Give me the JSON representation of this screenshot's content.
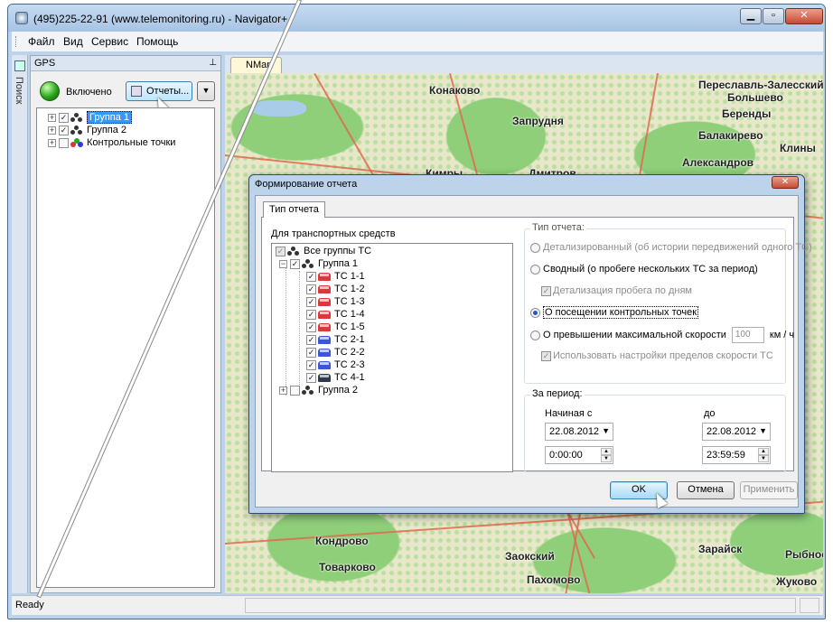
{
  "window": {
    "title": "(495)225-22-91  (www.telemonitoring.ru) - Navigator+",
    "minimize_glyph": "▁",
    "maximize_glyph": "▫",
    "close_glyph": "✕"
  },
  "menu": [
    "Файл",
    "Вид",
    "Сервис",
    "Помощь"
  ],
  "side_tab": "Поиск",
  "gps_panel": {
    "title": "GPS",
    "pin_glyph": "⊥",
    "status": "Включено",
    "reports_button": "Отчеты...",
    "dropdown_glyph": "▼",
    "tree": [
      {
        "label": "Группа 1",
        "checked": true,
        "selected": true
      },
      {
        "label": "Группа 2",
        "checked": true,
        "selected": false
      },
      {
        "label": "Контрольные точки",
        "checked": false,
        "selected": false
      }
    ]
  },
  "map": {
    "tab_label": "NMap",
    "cities": [
      "Переславль-Залесский",
      "Конаково",
      "Большево",
      "Беренды",
      "Запрудня",
      "Балакирево",
      "Клины",
      "Александров",
      "Кимры",
      "Дмитров",
      "Кондрово",
      "Товарково",
      "Заокский",
      "Пахомово",
      "Зарайск",
      "Рыбное",
      "Жуково"
    ]
  },
  "dialog": {
    "title": "Формирование отчета",
    "close_glyph": "✕",
    "tab": "Тип отчета",
    "vehicles": {
      "title": "Для транспортных средств",
      "root": "Все группы ТС",
      "group1": "Группа 1",
      "items": [
        {
          "label": "ТС 1-1",
          "color": "#d63b3b"
        },
        {
          "label": "ТС 1-2",
          "color": "#d63b3b"
        },
        {
          "label": "ТС 1-3",
          "color": "#d63b3b"
        },
        {
          "label": "ТС 1-4",
          "color": "#d63b3b"
        },
        {
          "label": "ТС 1-5",
          "color": "#d63b3b"
        },
        {
          "label": "ТС 2-1",
          "color": "#3a58d6"
        },
        {
          "label": "ТС 2-2",
          "color": "#3a58d6"
        },
        {
          "label": "ТС 2-3",
          "color": "#3a58d6"
        },
        {
          "label": "ТС 4-1",
          "color": "#2d3b4a"
        }
      ],
      "group2": "Группа 2"
    },
    "report_type": {
      "title": "Тип отчета:",
      "detailed": "Детализированный (об истории передвижений одного ТС)",
      "summary": "Сводный (о пробеге нескольких ТС за период)",
      "by_days": "Детализация пробега по дням",
      "checkpoints": "О посещении контрольных точек",
      "speeding": "О превышении максимальной скорости",
      "speed_value": "100",
      "speed_unit": "км / ч",
      "use_limits": "Использовать настройки пределов скорости ТС",
      "selected": "checkpoints"
    },
    "period": {
      "title": "За период:",
      "from_label": "Начиная с",
      "to_label": "до",
      "from_date": "22.08.2012",
      "to_date": "22.08.2012",
      "from_time": "0:00:00",
      "to_time": "23:59:59"
    },
    "buttons": {
      "ok": "OK",
      "cancel": "Отмена",
      "apply": "Применить"
    }
  },
  "statusbar": {
    "text": "Ready"
  }
}
